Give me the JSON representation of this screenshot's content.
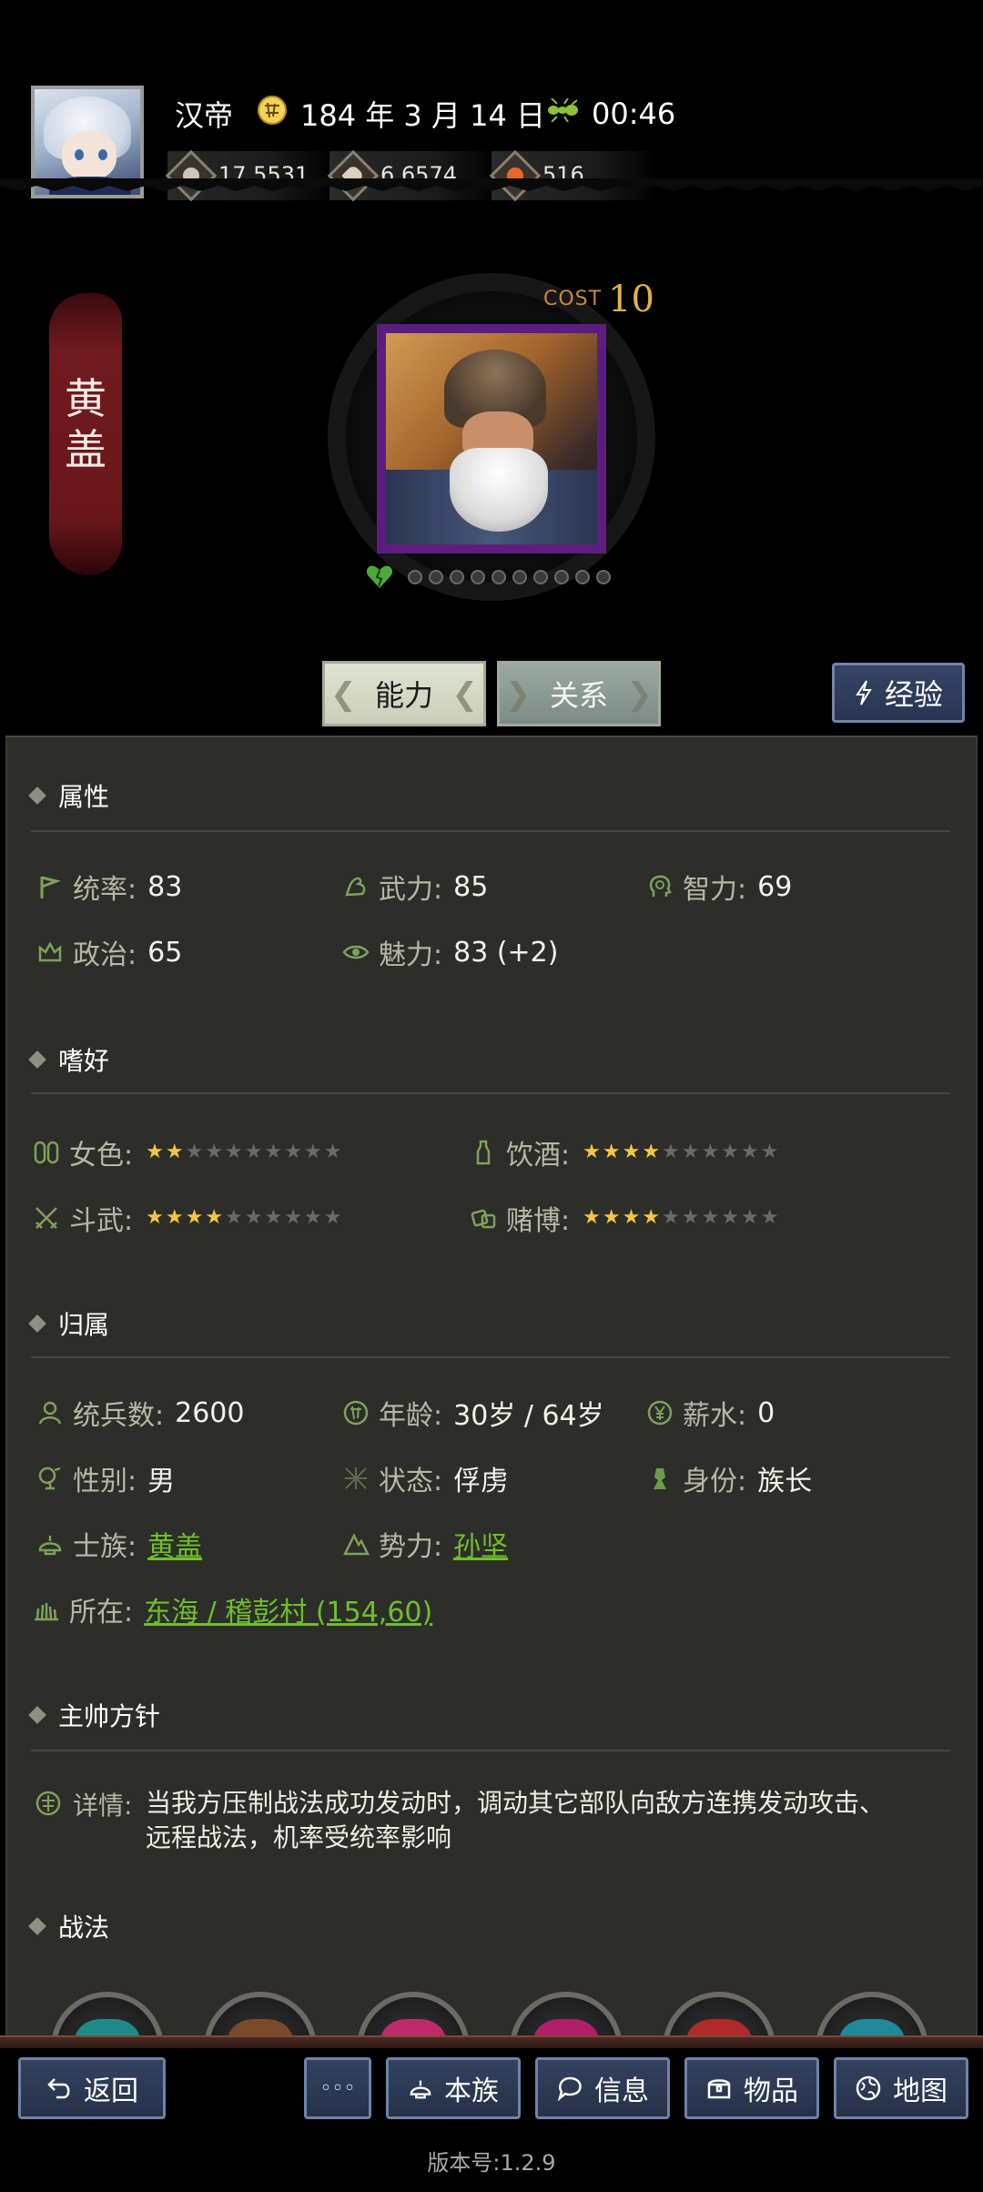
{
  "header": {
    "emperor": "汉帝",
    "date": "184 年 3 月 14 日",
    "time": "00:46",
    "resources": {
      "money": "17,5531",
      "food": "6,6574",
      "honor": "516"
    }
  },
  "hero": {
    "name_chars": [
      "黄",
      "盖"
    ],
    "cost_label": "COST",
    "cost_value": "10",
    "loyalty_dots_total": 10,
    "loyalty_dots_filled": 0
  },
  "tabs": {
    "ability": "能力",
    "relation": "关系",
    "experience": "经验"
  },
  "attributes": {
    "title": "属性",
    "command": {
      "label": "统率:",
      "value": "83"
    },
    "force": {
      "label": "武力:",
      "value": "85"
    },
    "intelligence": {
      "label": "智力:",
      "value": "69"
    },
    "politics": {
      "label": "政治:",
      "value": "65"
    },
    "charm": {
      "label": "魅力:",
      "value": "83 (+2)"
    }
  },
  "hobbies": {
    "title": "嗜好",
    "lust": {
      "label": "女色:",
      "stars": 2,
      "max": 10
    },
    "drinking": {
      "label": "饮酒:",
      "stars": 4,
      "max": 10
    },
    "fighting": {
      "label": "斗武:",
      "stars": 4,
      "max": 10
    },
    "gambling": {
      "label": "赌博:",
      "stars": 4,
      "max": 10
    }
  },
  "affiliation": {
    "title": "归属",
    "troops": {
      "label": "统兵数:",
      "value": "2600"
    },
    "age": {
      "label": "年龄:",
      "value": "30岁 / 64岁"
    },
    "salary": {
      "label": "薪水:",
      "value": "0"
    },
    "gender": {
      "label": "性别:",
      "value": "男"
    },
    "status": {
      "label": "状态:",
      "value": "俘虏"
    },
    "identity": {
      "label": "身份:",
      "value": "族长"
    },
    "clan": {
      "label": "士族:",
      "value": "黄盖"
    },
    "faction": {
      "label": "势力:",
      "value": "孙坚"
    },
    "location": {
      "label": "所在:",
      "value": "东海 / 稽彭村 (154,60)"
    }
  },
  "policy": {
    "title": "主帅方针",
    "detail_label": "详情:",
    "detail_text": "当我方压制战法成功发动时，调动其它部队向敌方连携发动攻击、远程战法，机率受统率影响"
  },
  "tactics": {
    "title": "战法",
    "icon_colors": [
      "#1e8a8a",
      "#7a4a2a",
      "#c02a6a",
      "#b0206a",
      "#b02a2a",
      "#1e8a9a"
    ]
  },
  "bottom_nav": {
    "back": "返回",
    "more": "◦◦◦",
    "clan": "本族",
    "info": "信息",
    "items": "物品",
    "map": "地图",
    "version": "版本号:1.2.9"
  },
  "colors": {
    "panel_bg": "#2d2e29",
    "link_green": "#6fbf2a",
    "star_gold": "#f5c542",
    "portrait_border": "#5b1e80",
    "banner_red": "#701a1f"
  }
}
